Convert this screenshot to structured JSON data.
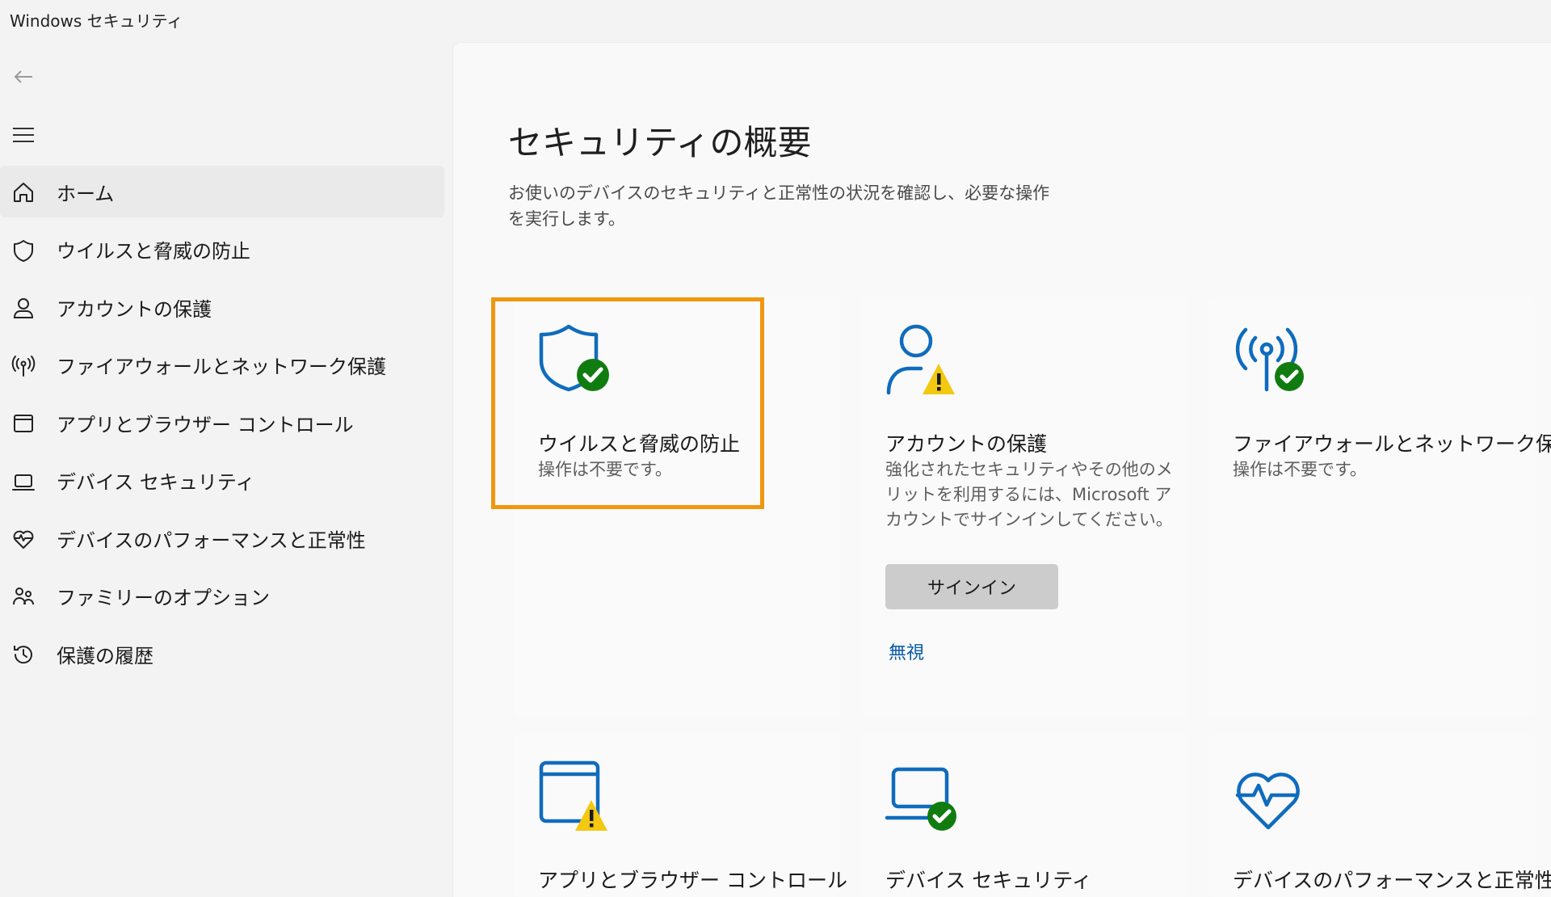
{
  "window": {
    "title": "Windows セキュリティ"
  },
  "sidebar": {
    "items": [
      {
        "label": "ホーム",
        "icon": "home-icon",
        "active": true
      },
      {
        "label": "ウイルスと脅威の防止",
        "icon": "shield-icon"
      },
      {
        "label": "アカウントの保護",
        "icon": "person-icon"
      },
      {
        "label": "ファイアウォールとネットワーク保護",
        "icon": "wireless-antenna-icon"
      },
      {
        "label": "アプリとブラウザー コントロール",
        "icon": "app-window-icon"
      },
      {
        "label": "デバイス セキュリティ",
        "icon": "laptop-icon"
      },
      {
        "label": "デバイスのパフォーマンスと正常性",
        "icon": "heart-pulse-icon"
      },
      {
        "label": "ファミリーのオプション",
        "icon": "family-icon"
      },
      {
        "label": "保護の履歴",
        "icon": "history-icon"
      }
    ]
  },
  "main": {
    "title": "セキュリティの概要",
    "description": "お使いのデバイスのセキュリティと正常性の状況を確認し、必要な操作を実行します。",
    "cards": [
      {
        "title": "ウイルスと脅威の防止",
        "status": "操作は不要です。",
        "icon": "shield-check-icon",
        "state": "ok"
      },
      {
        "title": "アカウントの保護",
        "status": "強化されたセキュリティやその他のメリットを利用するには、Microsoft アカウントでサインインしてください。",
        "icon": "person-warning-icon",
        "state": "warning",
        "button": "サインイン",
        "link": "無視"
      },
      {
        "title": "ファイアウォールとネットワーク保護",
        "status": "操作は不要です。",
        "icon": "antenna-check-icon",
        "state": "ok"
      },
      {
        "title": "アプリとブラウザー コントロール",
        "icon": "app-window-warning-icon",
        "state": "warning"
      },
      {
        "title": "デバイス セキュリティ",
        "icon": "laptop-check-icon",
        "state": "ok"
      },
      {
        "title": "デバイスのパフォーマンスと正常性",
        "icon": "heart-pulse-icon",
        "state": "ok"
      }
    ]
  },
  "colors": {
    "accent": "#0f6cbd",
    "ok": "#107c10",
    "warning": "#f2c811",
    "highlight": "#f0960f",
    "link": "#0a5aa6"
  }
}
